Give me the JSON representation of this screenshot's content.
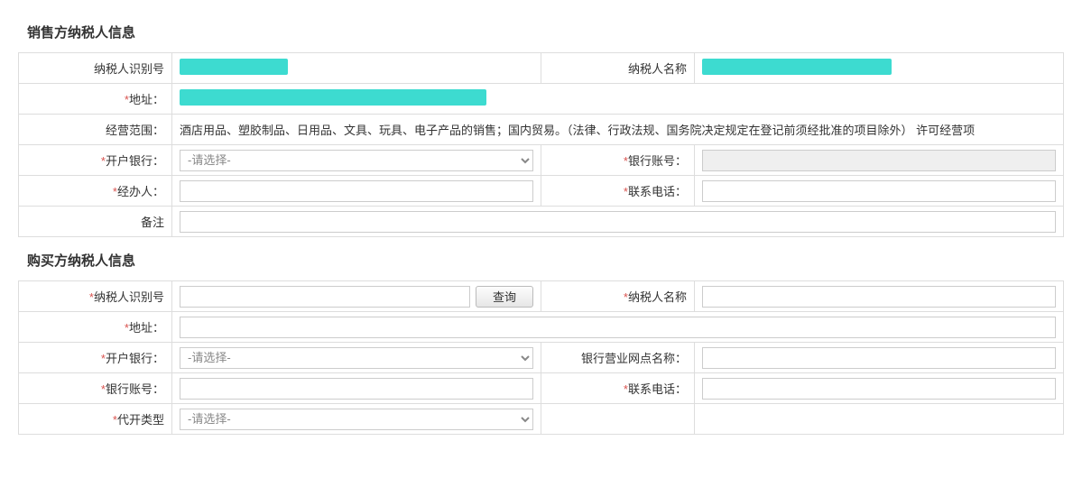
{
  "seller": {
    "title": "销售方纳税人信息",
    "taxpayer_id_label": "纳税人识别号",
    "taxpayer_name_label": "纳税人名称",
    "address_label": "地址：",
    "scope_label": "经营范围：",
    "scope_value": "酒店用品、塑胶制品、日用品、文具、玩具、电子产品的销售；国内贸易。（法律、行政法规、国务院决定规定在登记前须经批准的项目除外）  许可经营项",
    "bank_label": "开户银行：",
    "bank_placeholder": "-请选择-",
    "bank_account_label": "银行账号：",
    "handler_label": "经办人：",
    "phone_label": "联系电话：",
    "remark_label": "备注"
  },
  "buyer": {
    "title": "购买方纳税人信息",
    "taxpayer_id_label": "纳税人识别号",
    "query_btn": "查询",
    "taxpayer_name_label": "纳税人名称",
    "address_label": "地址：",
    "bank_label": "开户银行：",
    "bank_placeholder": "-请选择-",
    "branch_label": "银行营业网点名称：",
    "bank_account_label": "银行账号：",
    "phone_label": "联系电话：",
    "type_label": "代开类型",
    "type_placeholder": "-请选择-"
  }
}
